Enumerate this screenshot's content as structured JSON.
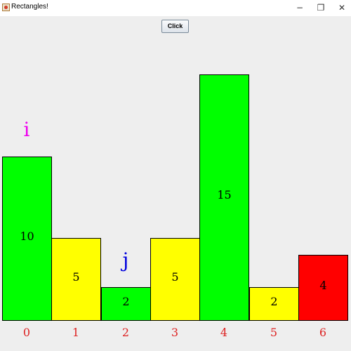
{
  "window": {
    "title": "Rectangles!",
    "minimize_glyph": "−",
    "maximize_glyph": "❐",
    "close_glyph": "✕",
    "icon": "java-icon"
  },
  "toolbar": {
    "click_label": "Click"
  },
  "colors": {
    "green": "#00ff00",
    "yellow": "#ffff00",
    "red": "#ff0000",
    "index_label": "#dd2222",
    "pointer_i": "#ee00ee",
    "pointer_j": "#0000dd"
  },
  "bars": [
    {
      "index": "0",
      "value": 10,
      "color": "green"
    },
    {
      "index": "1",
      "value": 5,
      "color": "yellow"
    },
    {
      "index": "2",
      "value": 2,
      "color": "green"
    },
    {
      "index": "3",
      "value": 5,
      "color": "yellow"
    },
    {
      "index": "4",
      "value": 15,
      "color": "green"
    },
    {
      "index": "5",
      "value": 2,
      "color": "yellow"
    },
    {
      "index": "6",
      "value": 4,
      "color": "red"
    }
  ],
  "pointers": [
    {
      "label": "i",
      "bar_index": 0,
      "color": "pointer_i"
    },
    {
      "label": "j",
      "bar_index": 2,
      "color": "pointer_j"
    }
  ]
}
